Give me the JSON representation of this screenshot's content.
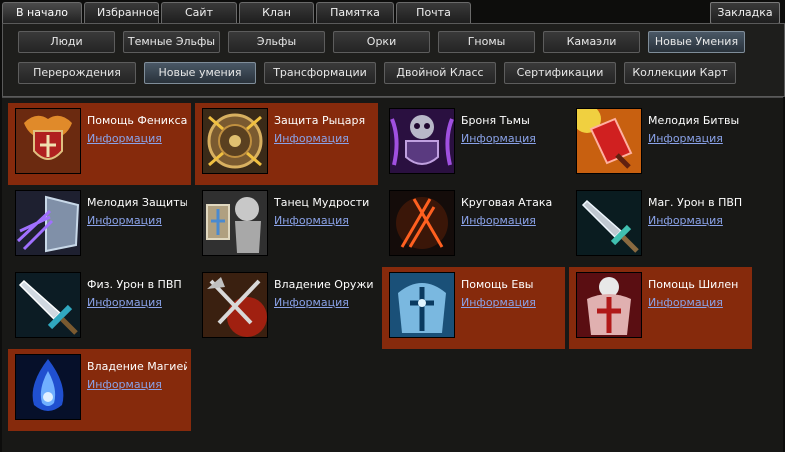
{
  "top_tabs": [
    {
      "label": "В начало",
      "active": true
    },
    {
      "label": "Избранное",
      "active": false
    },
    {
      "label": "Сайт игры",
      "active": false
    },
    {
      "label": "Клан",
      "active": false
    },
    {
      "label": "Памятка",
      "active": false
    },
    {
      "label": "Почта",
      "active": false
    }
  ],
  "bookmark_label": "Закладка",
  "categories_row1": [
    {
      "label": "Люди",
      "selected": false
    },
    {
      "label": "Темные Эльфы",
      "selected": false
    },
    {
      "label": "Эльфы",
      "selected": false
    },
    {
      "label": "Орки",
      "selected": false
    },
    {
      "label": "Гномы",
      "selected": false
    },
    {
      "label": "Камаэли",
      "selected": false
    },
    {
      "label": "Новые Умения",
      "selected": true
    }
  ],
  "categories_row2": [
    {
      "label": "Перерождения",
      "selected": false
    },
    {
      "label": "Новые умения",
      "selected": true
    },
    {
      "label": "Трансформации",
      "selected": false
    },
    {
      "label": "Двойной Класс",
      "selected": false
    },
    {
      "label": "Сертификации",
      "selected": false
    },
    {
      "label": "Коллекции Карт",
      "selected": false
    }
  ],
  "skills": [
    {
      "name": "Помощь Феникса",
      "info": "Информация",
      "highlighted": true,
      "icon": "phoenix-shield-icon"
    },
    {
      "name": "Защита Рыцаря",
      "info": "Информация",
      "highlighted": true,
      "icon": "round-shield-icon"
    },
    {
      "name": "Броня Тьмы",
      "info": "Информация",
      "highlighted": false,
      "icon": "dark-armor-icon"
    },
    {
      "name": "Мелодия Битвы",
      "info": "Информация",
      "highlighted": false,
      "icon": "battle-melody-icon"
    },
    {
      "name": "Мелодия Защиты",
      "info": "Информация",
      "highlighted": false,
      "icon": "defense-melody-icon"
    },
    {
      "name": "Танец Мудрости",
      "info": "Информация",
      "highlighted": false,
      "icon": "wisdom-dance-icon"
    },
    {
      "name": "Круговая Атака",
      "info": "Информация",
      "highlighted": false,
      "icon": "circle-attack-icon"
    },
    {
      "name": "Маг. Урон в ПВП",
      "info": "Информация",
      "highlighted": false,
      "icon": "magic-sword-icon"
    },
    {
      "name": "Физ. Урон в ПВП",
      "info": "Информация",
      "highlighted": false,
      "icon": "physical-sword-icon"
    },
    {
      "name": "Владение Оружи..",
      "info": "Информация",
      "highlighted": false,
      "icon": "weapon-mastery-icon"
    },
    {
      "name": "Помощь Евы",
      "info": "Информация",
      "highlighted": true,
      "icon": "eva-aid-icon"
    },
    {
      "name": "Помощь Шилен",
      "info": "Информация",
      "highlighted": true,
      "icon": "shilen-aid-icon"
    },
    {
      "name": "Владение Магией",
      "info": "Информация",
      "highlighted": true,
      "icon": "magic-mastery-icon"
    }
  ],
  "colors": {
    "highlight": "#862a0c",
    "link": "#8aa2e8",
    "background": "#181816"
  }
}
